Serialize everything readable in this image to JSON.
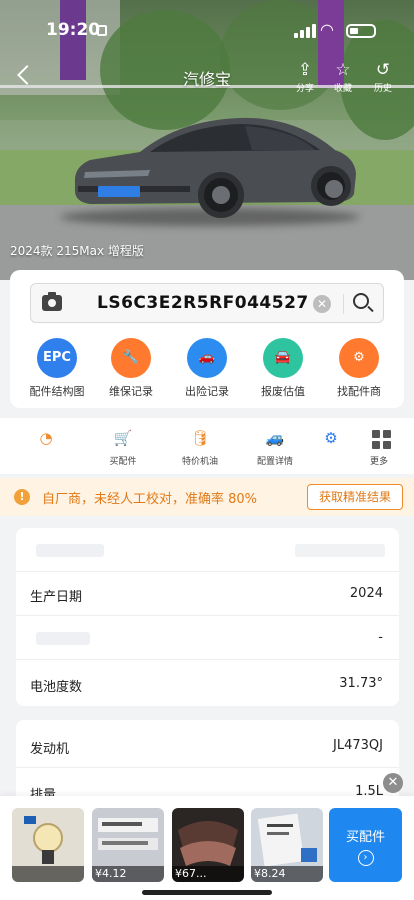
{
  "status_bar": {
    "time": "19:20"
  },
  "nav": {
    "title": "汽修宝",
    "actions": [
      {
        "icon": "share-icon",
        "label": "分享"
      },
      {
        "icon": "favorite-icon",
        "label": "收藏"
      },
      {
        "icon": "history-icon",
        "label": "历史"
      }
    ]
  },
  "hero": {
    "caption": "2024款 215Max 增程版"
  },
  "search": {
    "vin": "LS6C3E2R5RF044527"
  },
  "functions": [
    {
      "label": "配件结构图",
      "icon_text": "EPC",
      "color": "#2f80ed"
    },
    {
      "label": "维保记录",
      "icon_text": "🔧",
      "color": "#ff7a2e"
    },
    {
      "label": "出险记录",
      "icon_text": "🚗",
      "color": "#2d8cf0"
    },
    {
      "label": "报废估值",
      "icon_text": "🚘",
      "color": "#2ec4a0"
    },
    {
      "label": "找配件商",
      "icon_text": "⚙",
      "color": "#ff7a2e"
    }
  ],
  "shortcuts": [
    {
      "label": "",
      "icon": "◔",
      "color": "#f08a2a"
    },
    {
      "label": "买配件",
      "icon": "🛒",
      "color": "#e84a3c"
    },
    {
      "label": "特价机油",
      "icon": "🛢",
      "color": "#f08a2a"
    },
    {
      "label": "配置详情",
      "icon": "🚙",
      "color": "#2d7cf0"
    },
    {
      "label": "",
      "icon": "⚙",
      "color": "#2d7cf0"
    }
  ],
  "more_label": "更多",
  "notice": {
    "text": "自厂商，未经人工校对，准确率 80%",
    "button": "获取精准结果"
  },
  "info_card_1": [
    {
      "key": "",
      "value": "",
      "blurred": true
    },
    {
      "key": "生产日期",
      "value": "2024",
      "blurred": false
    },
    {
      "key": "",
      "value": "-",
      "blurred": true
    },
    {
      "key": "电池度数",
      "value": "31.73°",
      "blurred": false
    }
  ],
  "info_card_2": [
    {
      "key": "发动机",
      "value": "JL473QJ"
    },
    {
      "key": "排量",
      "value": "1.5L"
    }
  ],
  "products": [
    {
      "price": "",
      "icon": "bulb-icon"
    },
    {
      "price": "¥4.12",
      "icon": "sticker-icon"
    },
    {
      "price": "¥67...",
      "icon": "brake-pad-icon"
    },
    {
      "price": "¥8.24",
      "icon": "label-icon"
    }
  ],
  "buy_button": "买配件"
}
